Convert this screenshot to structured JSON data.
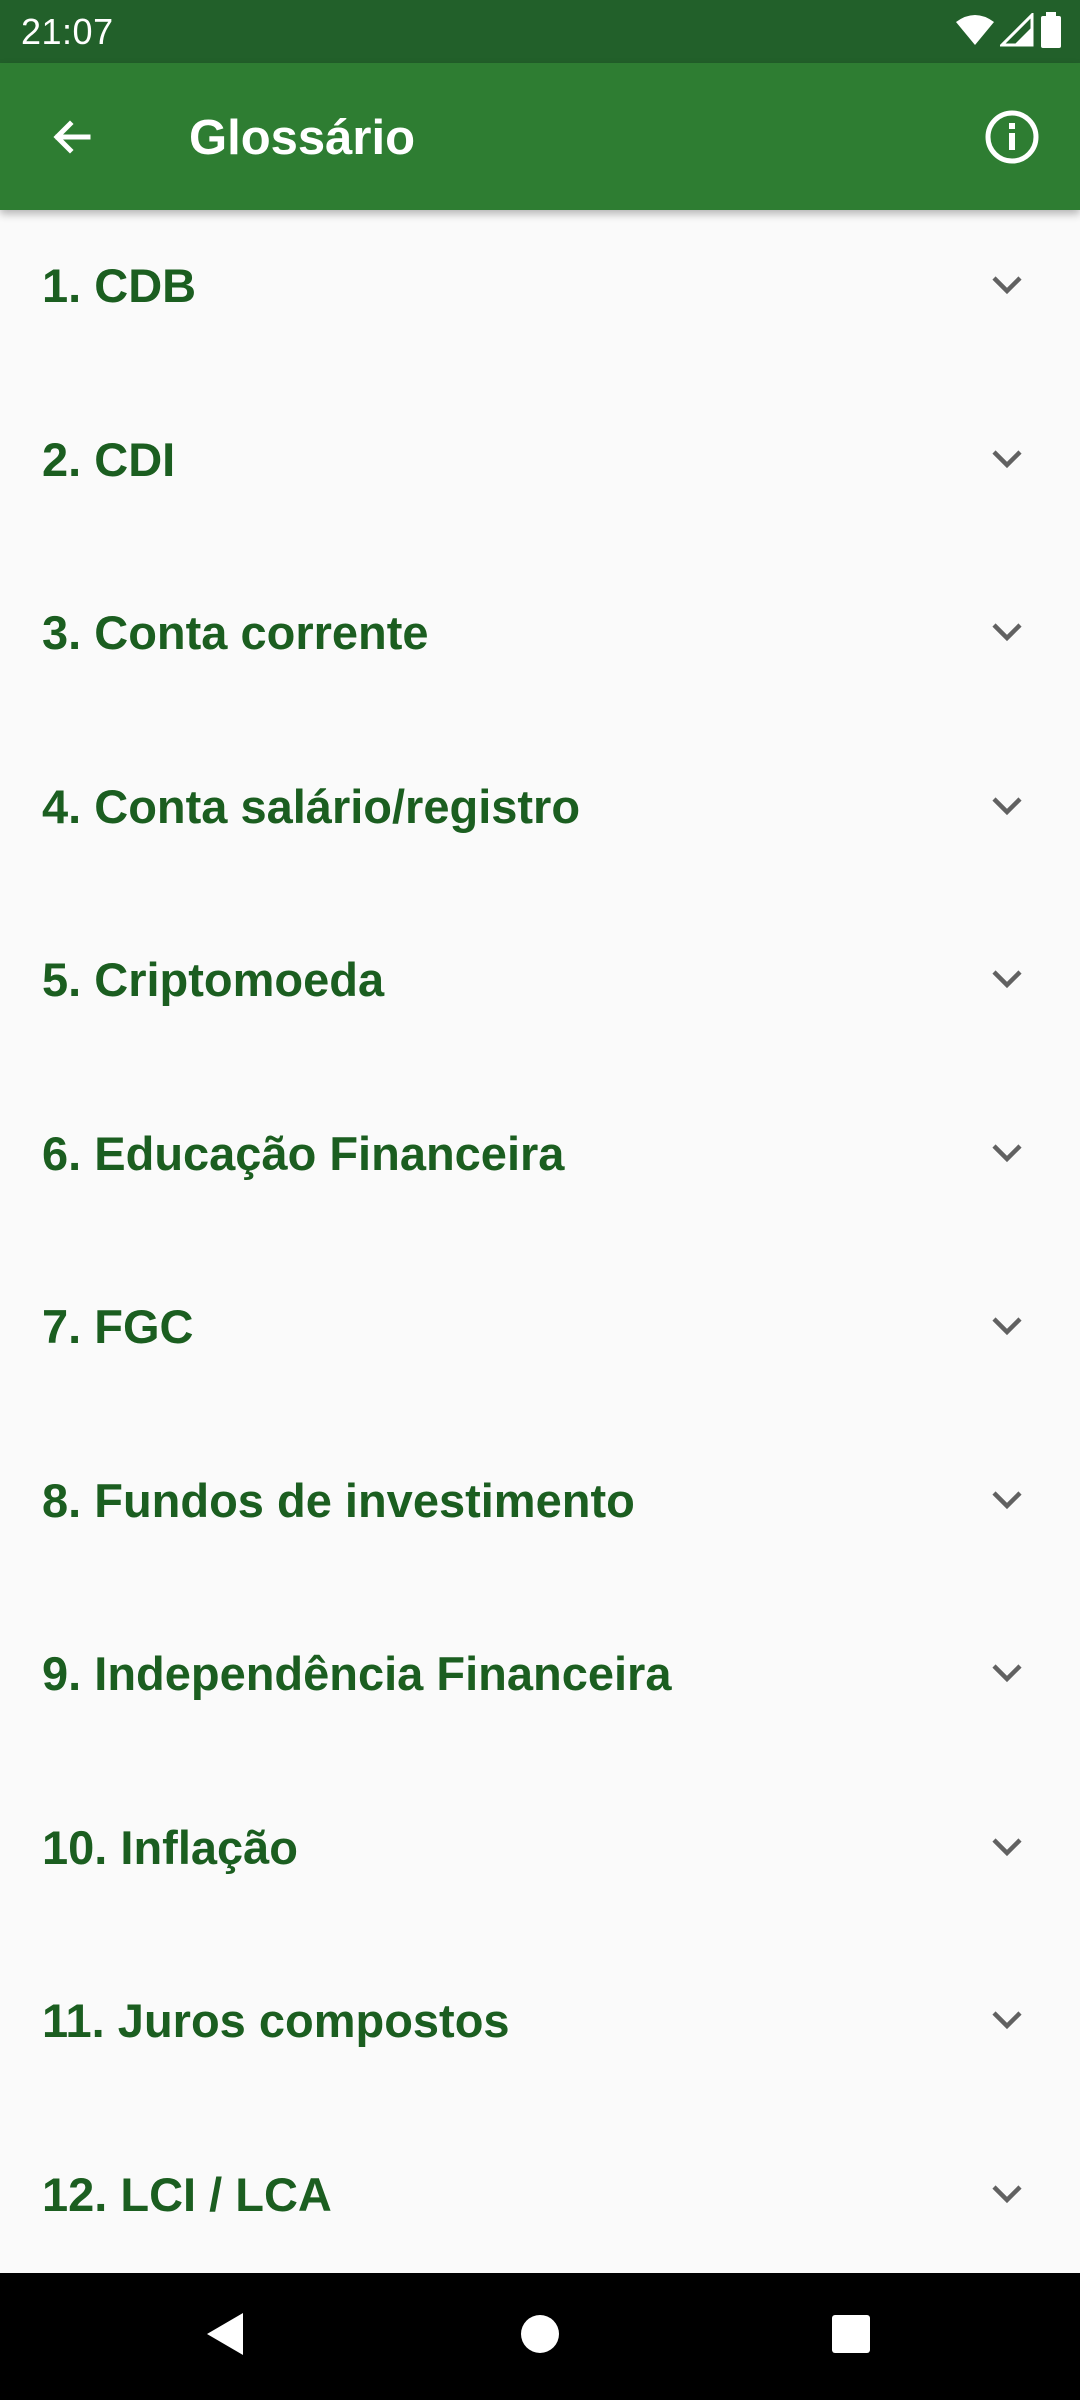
{
  "status_bar": {
    "time": "21:07",
    "icons": [
      "wifi-icon",
      "cell-signal-icon",
      "battery-icon"
    ]
  },
  "app_bar": {
    "title": "Glossário",
    "back_icon": "arrow-back-icon",
    "info_icon": "info-icon"
  },
  "glossary": {
    "items": [
      {
        "label": "1. CDB"
      },
      {
        "label": "2. CDI"
      },
      {
        "label": "3. Conta corrente"
      },
      {
        "label": "4. Conta salário/registro"
      },
      {
        "label": "5. Criptomoeda"
      },
      {
        "label": "6. Educação Financeira"
      },
      {
        "label": "7. FGC"
      },
      {
        "label": "8. Fundos de investimento"
      },
      {
        "label": "9. Independência Financeira"
      },
      {
        "label": "10. Inflação"
      },
      {
        "label": "11. Juros compostos"
      },
      {
        "label": "12. LCI / LCA"
      }
    ],
    "expand_icon": "chevron-down-icon"
  },
  "nav_bar": {
    "icons": [
      "nav-back-icon",
      "nav-home-icon",
      "nav-recents-icon"
    ]
  },
  "colors": {
    "status_bar": "#22602a",
    "app_bar": "#2e7d32",
    "item_text": "#1b5e20",
    "chevron": "#616161",
    "background": "#fafafa"
  }
}
